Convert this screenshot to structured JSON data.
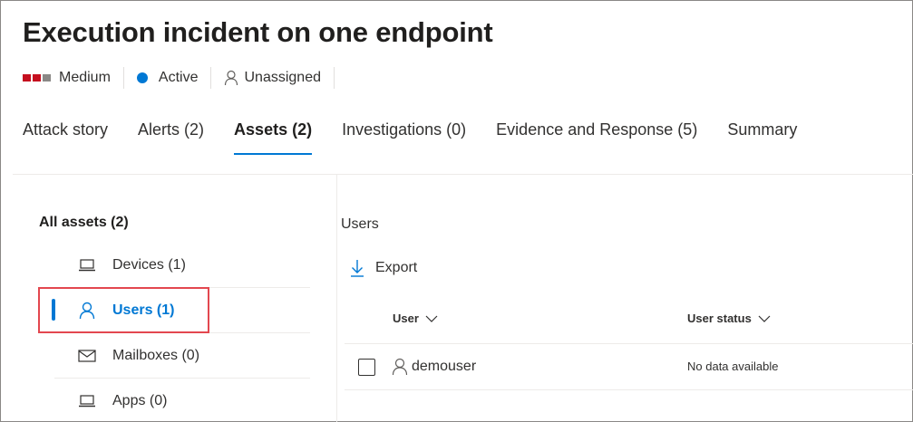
{
  "incident": {
    "title": "Execution incident on one endpoint",
    "severity": "Medium",
    "status": "Active",
    "assignee": "Unassigned"
  },
  "tabs": [
    {
      "label": "Attack story",
      "active": false
    },
    {
      "label": "Alerts (2)",
      "active": false
    },
    {
      "label": "Assets (2)",
      "active": true
    },
    {
      "label": "Investigations (0)",
      "active": false
    },
    {
      "label": "Evidence and Response (5)",
      "active": false
    },
    {
      "label": "Summary",
      "active": false
    }
  ],
  "sidebar": {
    "heading": "All assets (2)",
    "items": [
      {
        "label": "Devices (1)",
        "icon": "laptop-icon",
        "active": false
      },
      {
        "label": "Users (1)",
        "icon": "person-icon",
        "active": true
      },
      {
        "label": "Mailboxes (0)",
        "icon": "mail-icon",
        "active": false
      },
      {
        "label": "Apps (0)",
        "icon": "laptop-icon",
        "active": false
      }
    ]
  },
  "main": {
    "heading": "Users",
    "export_label": "Export",
    "columns": [
      "User",
      "User status"
    ],
    "rows": [
      {
        "user": "demouser",
        "status": "No data available"
      }
    ]
  },
  "colors": {
    "accent": "#0078d4",
    "severity_high": "#c50f1f",
    "highlight_box": "#e3474f"
  }
}
